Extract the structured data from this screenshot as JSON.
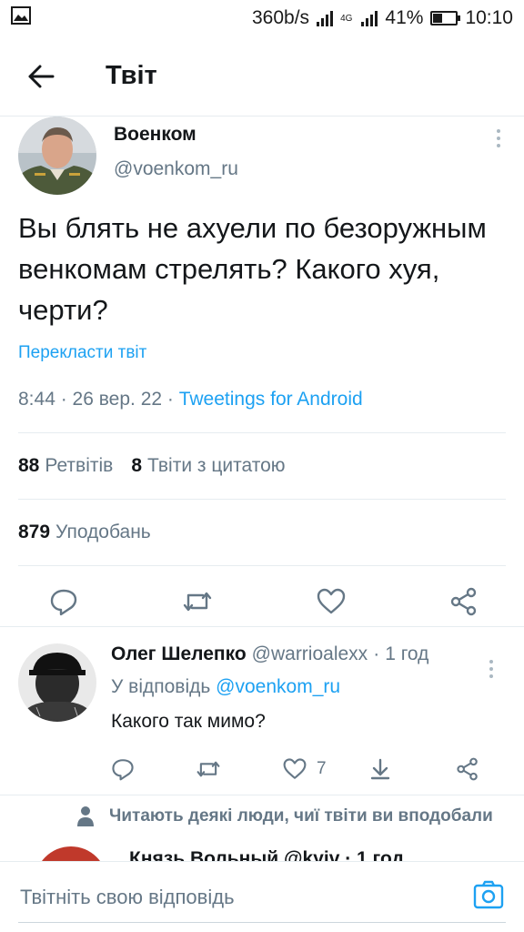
{
  "status_bar": {
    "speed": "360b/s",
    "network": "4G",
    "battery": "41%",
    "battery_level": 0.41,
    "time": "10:10"
  },
  "header": {
    "back_icon": "arrow-left-icon",
    "title": "Твіт"
  },
  "tweet": {
    "author_name": "Военком",
    "author_handle": "@voenkom_ru",
    "text": "Вы блять не ахуели по безоружным венкомам стрелять? Какого хуя, черти?",
    "translate_label": "Перекласти твіт",
    "time": "8:44",
    "date": "26 вер. 22",
    "app": "Tweetings for Android",
    "retweets_count": "88",
    "retweets_label": "Ретвітів",
    "quotes_count": "8",
    "quotes_label": "Твіти з цитатою",
    "likes_count": "879",
    "likes_label": "Уподобань"
  },
  "reply": {
    "name": "Олег Шелепко",
    "handle": "@warrioalexx",
    "time": "1 год",
    "reply_to_label": "У відповідь",
    "reply_to_handle": "@voenkom_ru",
    "text": "Какого так мимо?",
    "likes": "7"
  },
  "context": {
    "label": "Читають деякі люди, чиї твіти ви вподобали"
  },
  "peek": {
    "text": "Князь Вольный  @kyiv ·  1 год"
  },
  "compose": {
    "placeholder": "Твітніть свою відповідь"
  },
  "colors": {
    "accent": "#1da1f2",
    "muted": "#657786",
    "divider": "#e6ecf0"
  }
}
